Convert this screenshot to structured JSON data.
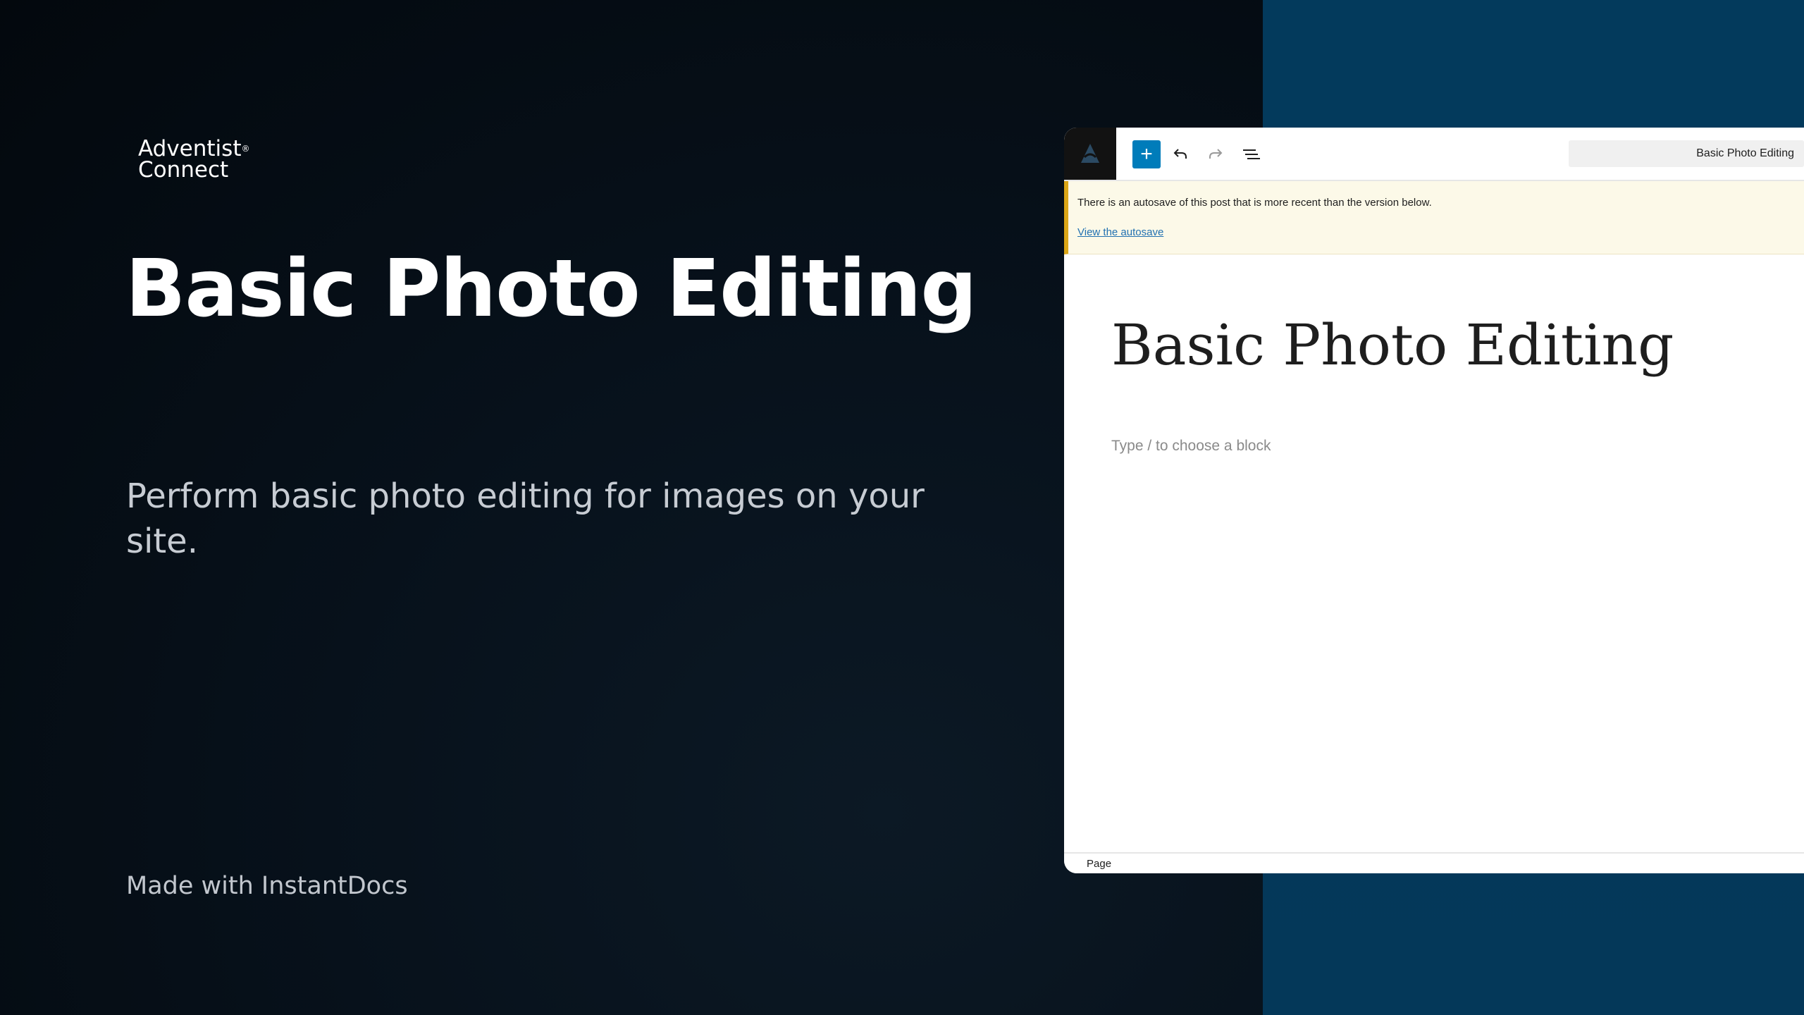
{
  "brand": {
    "line1": "Adventist",
    "line2": "Connect",
    "mark": "®"
  },
  "hero": {
    "title": "Basic Photo Editing",
    "subtitle": "Perform basic photo editing for images on your site.",
    "footer": "Made with InstantDocs"
  },
  "editor": {
    "toolbar": {
      "add_icon": "plus-icon",
      "undo_icon": "undo-icon",
      "redo_icon": "redo-icon",
      "list_view_icon": "list-view-icon",
      "document_title": "Basic Photo Editing"
    },
    "notice": {
      "message": "There is an autosave of this post that is more recent than the version below.",
      "link": "View the autosave"
    },
    "post_title": "Basic Photo Editing",
    "block_placeholder": "Type / to choose a block",
    "footer_label": "Page"
  },
  "colors": {
    "accent": "#007cba",
    "right_panel": "#043859",
    "notice_bg": "#fcf9e8",
    "notice_border": "#dba617",
    "link": "#2271b1"
  }
}
